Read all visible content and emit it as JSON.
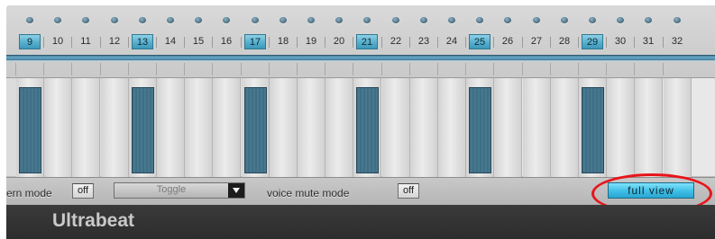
{
  "steps": [
    "9",
    "10",
    "11",
    "12",
    "13",
    "14",
    "15",
    "16",
    "17",
    "18",
    "19",
    "20",
    "21",
    "22",
    "23",
    "24",
    "25",
    "26",
    "27",
    "28",
    "29",
    "30",
    "31",
    "32"
  ],
  "highlighted_steps": [
    "9",
    "13",
    "17",
    "21",
    "25",
    "29"
  ],
  "bottom_bar": {
    "pattern_mode_label": "ern mode",
    "pattern_mode_value": "off",
    "select_value": "Toggle",
    "voice_mute_label": "voice mute mode",
    "voice_mute_value": "off",
    "full_view_label": "full view"
  },
  "footer": {
    "brand": "Ultrabeat"
  },
  "colors": {
    "accent": "#3fbee6",
    "step_bar": "#3c6a80",
    "annotation_circle": "#e8151b"
  }
}
